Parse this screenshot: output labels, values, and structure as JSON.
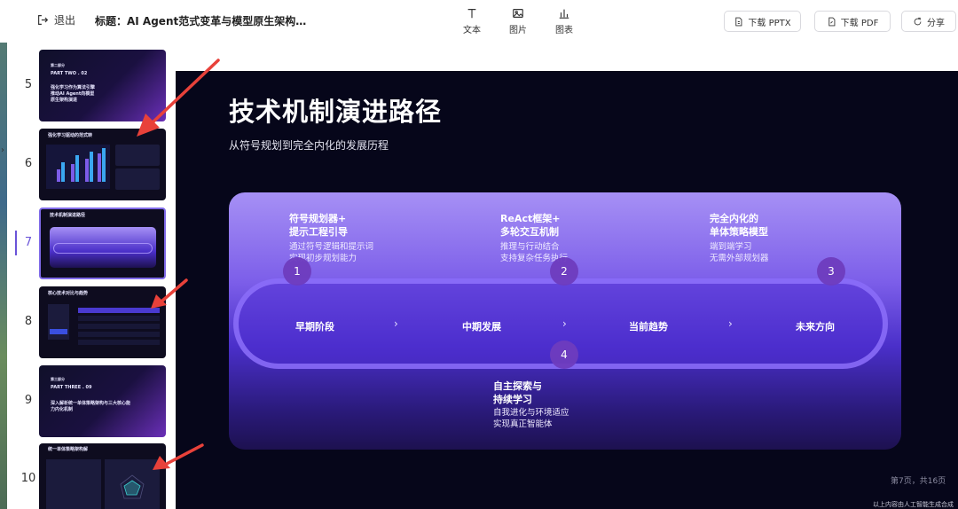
{
  "toolbar": {
    "exit_label": "退出",
    "title": "标题：AI Agent范式变革与模型原生架构…",
    "tools": [
      {
        "label": "文本",
        "icon": "text-icon"
      },
      {
        "label": "图片",
        "icon": "image-icon"
      },
      {
        "label": "图表",
        "icon": "chart-icon"
      }
    ],
    "download_pptx": "下载 PPTX",
    "download_pdf": "下载 PDF",
    "share": "分享"
  },
  "thumbnails": [
    {
      "num": "5",
      "lines": [
        "第二部分",
        "PART TWO . 02",
        "强化学习作为算法引擎",
        "推动AI Agent向模型",
        "原生架构演进"
      ]
    },
    {
      "num": "6",
      "lines": [
        "强化学习驱动的范式转"
      ]
    },
    {
      "num": "7",
      "lines": [
        "技术机制演进路径"
      ],
      "active": true
    },
    {
      "num": "8",
      "lines": [
        "核心技术对比与趋势"
      ]
    },
    {
      "num": "9",
      "lines": [
        "第三部分",
        "PART THREE . 09",
        "深入解析统一单体策略架构与三大核心能",
        "力内化机制"
      ]
    },
    {
      "num": "10",
      "lines": [
        "统一单体策略架构解"
      ]
    }
  ],
  "slide": {
    "title": "技术机制演进路径",
    "subtitle": "从符号规划到完全内化的发展历程",
    "stages": [
      "早期阶段",
      "中期发展",
      "当前趋势",
      "未来方向"
    ],
    "steps": [
      {
        "num": "1",
        "heading": [
          "符号规划器+",
          "提示工程引导"
        ],
        "desc": [
          "通过符号逻辑和提示词",
          "实现初步规划能力"
        ]
      },
      {
        "num": "2",
        "heading": [
          "ReAct框架+",
          "多轮交互机制"
        ],
        "desc": [
          "推理与行动结合",
          "支持复杂任务执行"
        ]
      },
      {
        "num": "3",
        "heading": [
          "完全内化的",
          "单体策略模型"
        ],
        "desc": [
          "端到端学习",
          "无需外部规划器"
        ]
      },
      {
        "num": "4",
        "heading": [
          "自主探索与",
          "持续学习"
        ],
        "desc": [
          "自我进化与环境适应",
          "实现真正智能体"
        ]
      }
    ],
    "page_indicator": "第7页，共16页",
    "ai_note": "以上内容由人工智能生成合成"
  },
  "colors": {
    "accent": "#6a54d8",
    "slide_bg": "#06061a",
    "annotation_arrow": "#e8413a"
  }
}
